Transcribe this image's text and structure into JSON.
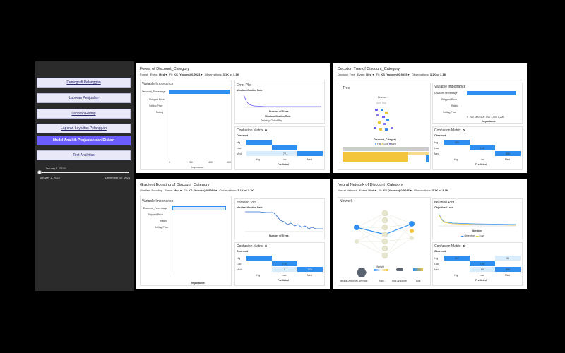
{
  "sidebar": {
    "items": [
      {
        "label": "Demografi Pelanggan",
        "active": false
      },
      {
        "label": "Laporan Penjualan",
        "active": false
      },
      {
        "label": "Laporan Rating",
        "active": false
      },
      {
        "label": "Laporan Loyalitas Pelanggan",
        "active": false
      },
      {
        "label": "Model Analitik Penjualan dan Diskon",
        "active": true
      },
      {
        "label": "Text Analytics",
        "active": false
      }
    ],
    "date_filter": {
      "label": "January 1, 2024 - ...",
      "start": "January 1, 2024",
      "end": "December 30, 2024"
    }
  },
  "panels": {
    "forest": {
      "title": "Forest of Discount_Category",
      "subtitle": {
        "model": "Forest",
        "event_label": "Event:",
        "event": "Med",
        "fit_label": "Fit:",
        "fit": "KS (Youden) 0.9923",
        "obs_label": "Observations:",
        "obs": "3.1K of 3.1K"
      },
      "vi_title": "Variable Importance",
      "vi_vars": [
        "Discount_Percentage",
        "Shipped Price",
        "Selling Price",
        "Rating"
      ],
      "vi_values": [
        0.95,
        0.0,
        0.0,
        0.0
      ],
      "vi_ticks": [
        "0",
        "200",
        "400",
        "600"
      ],
      "vi_xlabel": "Importance",
      "err_title": "Error Plot",
      "err_ylabel": "Misclassification Rate",
      "err_xlabel": "Number of Trees",
      "err_ylabel2": "Misclassification Rate",
      "err_legend": [
        "Training",
        "Out of Bag"
      ],
      "cm_title": "Confusion Matrix",
      "cm_observed": "Observed",
      "cm_predicted": "Predicted",
      "cm_rows": [
        "Hig",
        "Low",
        "Med"
      ],
      "cm_cols": [
        "Hig",
        "Low",
        "Med"
      ],
      "cm_values": [
        [
          "",
          "",
          ""
        ],
        [
          "",
          "",
          ""
        ],
        [
          "",
          "72",
          ""
        ]
      ]
    },
    "tree": {
      "title": "Decision Tree of Discount_Category",
      "subtitle": {
        "model": "Decision Tree",
        "event_label": "Event:",
        "event": "Med",
        "fit_label": "Fit:",
        "fit": "KS (Youden) 0.9939",
        "obs_label": "Observations:",
        "obs": "3.1K of 3.1K"
      },
      "tree_title": "Tree",
      "tree_root": "Discou...",
      "tree_legend_title": "Discount_Category",
      "tree_legend": [
        "Hig",
        "Low",
        "Med"
      ],
      "vi_title": "Variable Importance",
      "vi_vars": [
        "Discount Percentage",
        "Shipped Price",
        "Rating",
        "Selling Price"
      ],
      "vi_values": [
        1.0,
        0.0,
        0.0,
        0.0
      ],
      "vi_ticks": [
        "0",
        "200",
        "400",
        "600",
        "800",
        "1,000",
        "1,200"
      ],
      "vi_xlabel": "Importance",
      "cm_title": "Confusion Matrix",
      "cm_observed": "Observed",
      "cm_predicted": "Predicted",
      "cm_rows": [
        "Hig",
        "Low",
        "Med"
      ],
      "cm_cols": [
        "Hig",
        "Low",
        "Med"
      ],
      "cm_values": [
        [
          "520",
          "",
          ""
        ],
        [
          "",
          "1.1K",
          ""
        ],
        [
          "",
          "",
          "826"
        ]
      ]
    },
    "gb": {
      "title": "Gradient Boosting of Discount_Category",
      "subtitle": {
        "model": "Gradient Boosting",
        "event_label": "Event:",
        "event": "Med",
        "fit_label": "Fit:",
        "fit": "KS (Youden) 0.9964",
        "obs_label": "Observations:",
        "obs": "3.1K of 3.1K"
      },
      "vi_title": "Variable Importance",
      "vi_vars": [
        "Discount_Percentage",
        "Shipped Price",
        "Rating",
        "Selling Price"
      ],
      "vi_values": [
        1.0,
        0.0,
        0.0,
        0.0
      ],
      "vi_xlabel": "Importance",
      "it_title": "Iteration Plot",
      "it_ylabel": "Misclassification Rate",
      "it_xlabel": "Number of Trees",
      "cm_title": "Confusion Matrix",
      "cm_observed": "Observed",
      "cm_predicted": "Predicted",
      "cm_rows": [
        "Hig",
        "Low",
        "Med"
      ],
      "cm_cols": [
        "Hig",
        "Low",
        "Med"
      ],
      "cm_values": [
        [
          "",
          "",
          ""
        ],
        [
          "",
          "1.1K",
          ""
        ],
        [
          "",
          "2",
          "826"
        ]
      ]
    },
    "nn": {
      "title": "Neural Network of Discount_Category",
      "subtitle": {
        "model": "Neural Network",
        "event_label": "Event:",
        "event": "Med",
        "fit_label": "Fit:",
        "fit": "KS (Youden) 0.9745",
        "obs_label": "Observations:",
        "obs": "3.1K of 3.1K"
      },
      "net_title": "Network",
      "net_legend": [
        "Neuron Absolute Average",
        "Weight",
        "Neu...",
        "Link Absolute",
        "Link"
      ],
      "it_title": "Iteration Plot",
      "it_ylabel": "Objective / Loss",
      "it_xlabel": "Iteration",
      "it_legend": [
        "Objective",
        "Loss"
      ],
      "cm_title": "Confusion Matrix",
      "cm_observed": "Observed",
      "cm_predicted": "Predicted",
      "cm_rows": [
        "Hig",
        "Low",
        "Med"
      ],
      "cm_cols": [
        "Hig",
        "Low",
        "Med"
      ],
      "cm_values": [
        [
          "517",
          "",
          "38"
        ],
        [
          "",
          "1.0K",
          ""
        ],
        [
          "",
          "60",
          "826"
        ]
      ]
    }
  },
  "colors": {
    "accent": "#6b5cff",
    "blue": "#2f8ff0",
    "light_blue": "#d9ecfc",
    "yellow": "#f2c53d",
    "purple": "#8a7cf0",
    "sidebar_bg": "#2b2b2b"
  }
}
